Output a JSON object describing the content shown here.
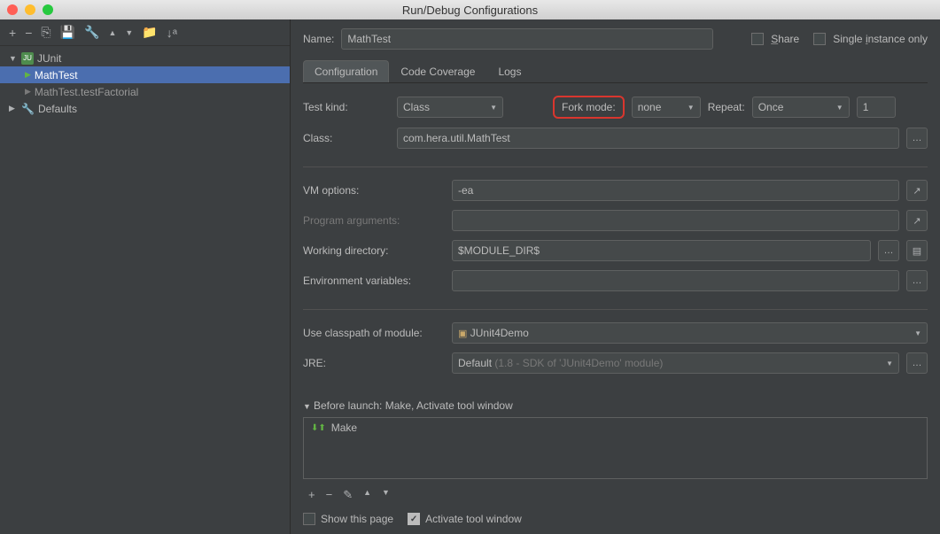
{
  "window": {
    "title": "Run/Debug Configurations"
  },
  "sidebar": {
    "root": "JUnit",
    "items": [
      "MathTest",
      "MathTest.testFactorial"
    ],
    "defaults": "Defaults"
  },
  "form": {
    "name_label": "Name:",
    "name_value": "MathTest",
    "share": "Share",
    "single_instance": "Single instance only"
  },
  "tabs": [
    "Configuration",
    "Code Coverage",
    "Logs"
  ],
  "config": {
    "test_kind_label": "Test kind:",
    "test_kind_value": "Class",
    "fork_mode_label": "Fork mode:",
    "fork_mode_value": "none",
    "repeat_label": "Repeat:",
    "repeat_value": "Once",
    "repeat_count": "1",
    "class_label": "Class:",
    "class_value": "com.hera.util.MathTest",
    "vm_label": "VM options:",
    "vm_value": "-ea",
    "prog_args_label": "Program arguments:",
    "workdir_label": "Working directory:",
    "workdir_value": "$MODULE_DIR$",
    "env_label": "Environment variables:",
    "classpath_label": "Use classpath of module:",
    "classpath_value": "JUnit4Demo",
    "jre_label": "JRE:",
    "jre_value": "Default",
    "jre_hint": "(1.8 - SDK of 'JUnit4Demo' module)"
  },
  "before_launch": {
    "header": "Before launch: Make, Activate tool window",
    "item": "Make",
    "show_page": "Show this page",
    "activate": "Activate tool window"
  }
}
